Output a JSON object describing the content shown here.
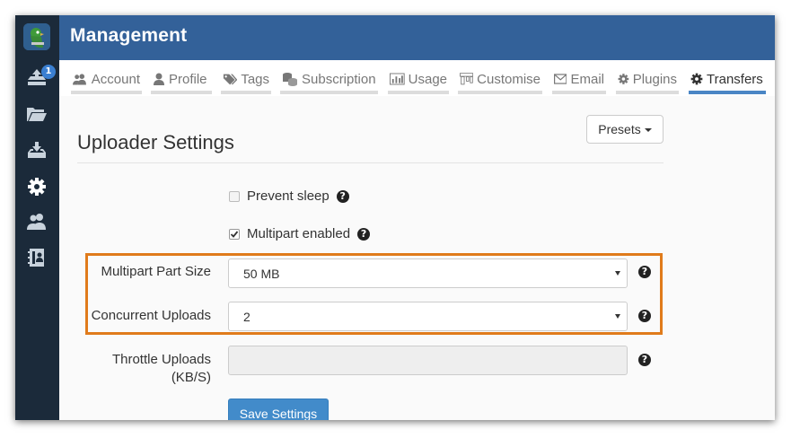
{
  "app": {
    "title": "Management",
    "upload_badge_count": "1"
  },
  "sidebar": {
    "items": [
      {
        "icon": "upload-tray-icon"
      },
      {
        "icon": "folder-open-icon"
      },
      {
        "icon": "download-tray-icon"
      },
      {
        "icon": "gear-icon"
      },
      {
        "icon": "users-icon"
      },
      {
        "icon": "address-book-icon"
      }
    ]
  },
  "tabs": [
    {
      "label": "Account",
      "icon": "user-group-icon",
      "active": false
    },
    {
      "label": "Profile",
      "icon": "user-icon",
      "active": false
    },
    {
      "label": "Tags",
      "icon": "tags-icon",
      "active": false
    },
    {
      "label": "Subscription",
      "icon": "coins-icon",
      "active": false
    },
    {
      "label": "Usage",
      "icon": "bar-chart-icon",
      "active": false
    },
    {
      "label": "Customise",
      "icon": "columns-icon",
      "active": false
    },
    {
      "label": "Email",
      "icon": "envelope-icon",
      "active": false
    },
    {
      "label": "Plugins",
      "icon": "gear-icon",
      "active": false
    },
    {
      "label": "Transfers",
      "icon": "gear-icon",
      "active": true
    }
  ],
  "page": {
    "title": "Uploader Settings",
    "presets_label": "Presets"
  },
  "form": {
    "prevent_sleep": {
      "label": "Prevent sleep",
      "checked": false
    },
    "multipart_enabled": {
      "label": "Multipart enabled",
      "checked": true
    },
    "part_size": {
      "label": "Multipart Part Size",
      "value": "50 MB"
    },
    "concurrent_uploads": {
      "label": "Concurrent Uploads",
      "value": "2"
    },
    "throttle": {
      "label_line1": "Throttle Uploads",
      "label_line2": "(KB/S)",
      "value": ""
    },
    "help_glyph": "?",
    "save_label": "Save Settings"
  },
  "colors": {
    "header": "#336199",
    "sidebar": "#1b2a3a",
    "active_tab": "#4a86c5",
    "highlight": "#e07b1b",
    "primary_button": "#428bca"
  }
}
